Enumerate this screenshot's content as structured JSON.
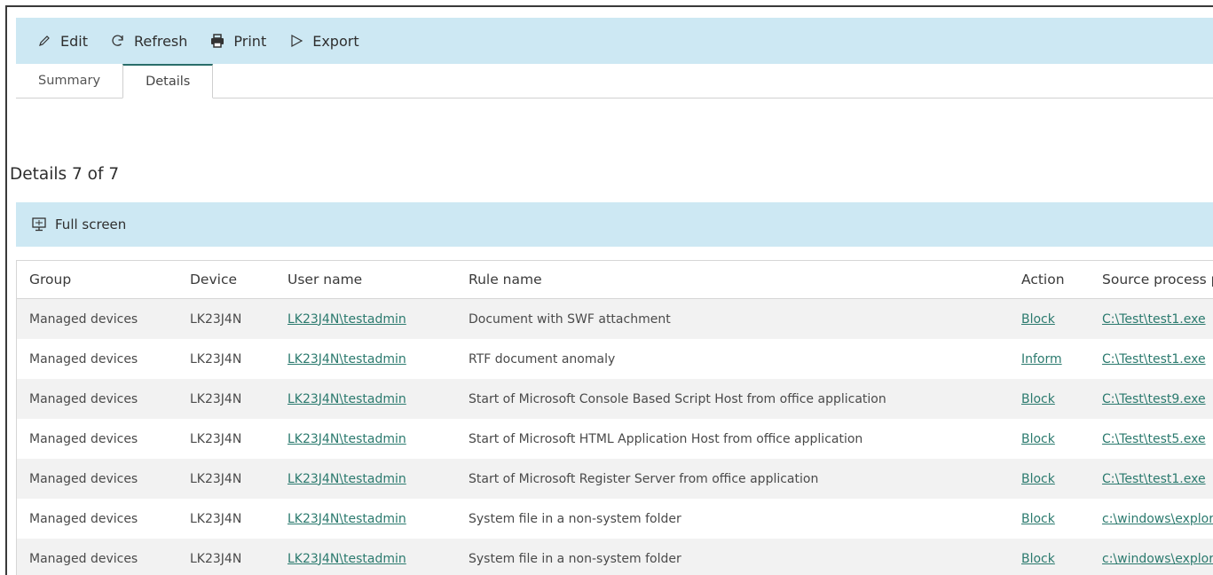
{
  "toolbar": {
    "edit_label": "Edit",
    "refresh_label": "Refresh",
    "print_label": "Print",
    "export_label": "Export"
  },
  "tabs": [
    {
      "label": "Summary",
      "active": false
    },
    {
      "label": "Details",
      "active": true
    }
  ],
  "section": {
    "title": "Details 7 of 7",
    "fullscreen_label": "Full screen"
  },
  "table": {
    "columns": [
      "Group",
      "Device",
      "User name",
      "Rule name",
      "Action",
      "Source process pa"
    ],
    "rows": [
      {
        "group": "Managed devices",
        "device": "LK23J4N",
        "user": "LK23J4N\\testadmin",
        "rule": "Document with SWF attachment",
        "action": "Block",
        "source": "C:\\Test\\test1.exe"
      },
      {
        "group": "Managed devices",
        "device": "LK23J4N",
        "user": "LK23J4N\\testadmin",
        "rule": "RTF document anomaly",
        "action": "Inform",
        "source": "C:\\Test\\test1.exe"
      },
      {
        "group": "Managed devices",
        "device": "LK23J4N",
        "user": "LK23J4N\\testadmin",
        "rule": "Start of Microsoft Console Based Script Host from office application",
        "action": "Block",
        "source": "C:\\Test\\test9.exe"
      },
      {
        "group": "Managed devices",
        "device": "LK23J4N",
        "user": "LK23J4N\\testadmin",
        "rule": "Start of Microsoft HTML Application Host from office application",
        "action": "Block",
        "source": "C:\\Test\\test5.exe"
      },
      {
        "group": "Managed devices",
        "device": "LK23J4N",
        "user": "LK23J4N\\testadmin",
        "rule": "Start of Microsoft Register Server from office application",
        "action": "Block",
        "source": "C:\\Test\\test1.exe"
      },
      {
        "group": "Managed devices",
        "device": "LK23J4N",
        "user": "LK23J4N\\testadmin",
        "rule": "System file in a non-system folder",
        "action": "Block",
        "source": "c:\\windows\\explor"
      },
      {
        "group": "Managed devices",
        "device": "LK23J4N",
        "user": "LK23J4N\\testadmin",
        "rule": "System file in a non-system folder",
        "action": "Block",
        "source": "c:\\windows\\explor"
      }
    ]
  },
  "icons": {
    "edit": "pencil-icon",
    "refresh": "refresh-icon",
    "print": "printer-icon",
    "export": "export-icon",
    "fullscreen": "monitor-icon"
  },
  "colors": {
    "toolbar_bg": "#cde8f3",
    "link": "#2b7a6e",
    "active_tab_border": "#2a6e6a",
    "row_alt": "#f2f2f2"
  }
}
